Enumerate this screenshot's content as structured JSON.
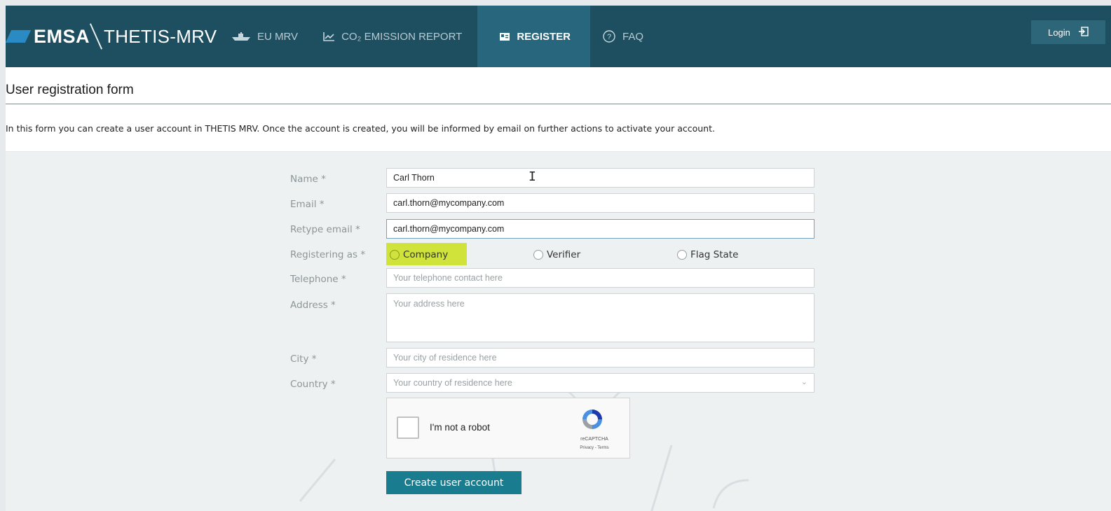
{
  "header": {
    "brand_logo": "EMSA",
    "brand_app": "THETIS-MRV",
    "nav": [
      {
        "label": "EU MRV",
        "icon": "ship-icon"
      },
      {
        "label": "CO₂ EMISSION REPORT",
        "icon": "chart-icon"
      },
      {
        "label": "REGISTER",
        "icon": "register-icon",
        "active": true
      },
      {
        "label": "FAQ",
        "icon": "help-icon"
      }
    ],
    "login_label": "Login"
  },
  "page": {
    "title": "User registration form",
    "intro": "In this form you can create a user account in THETIS MRV. Once the account is created, you will be informed by email on further actions to activate your account."
  },
  "form": {
    "name_label": "Name *",
    "name_value": "Carl Thorn",
    "email_label": "Email *",
    "email_value": "carl.thorn@mycompany.com",
    "retype_label": "Retype email *",
    "retype_value": "carl.thorn@mycompany.com",
    "registering_label": "Registering as *",
    "registering_options": [
      "Company",
      "Verifier",
      "Flag State"
    ],
    "telephone_label": "Telephone *",
    "telephone_placeholder": "Your telephone contact here",
    "address_label": "Address *",
    "address_placeholder": "Your address here",
    "city_label": "City *",
    "city_placeholder": "Your city of residence here",
    "country_label": "Country *",
    "country_placeholder": "Your country of residence here",
    "captcha_text": "I'm not a robot",
    "captcha_brand": "reCAPTCHA",
    "captcha_links": "Privacy - Terms",
    "submit_label": "Create user account"
  },
  "colors": {
    "navbar": "#1d4f61",
    "nav_active": "#27667d",
    "submit": "#1a7d8f",
    "highlight": "#cfe33b"
  }
}
